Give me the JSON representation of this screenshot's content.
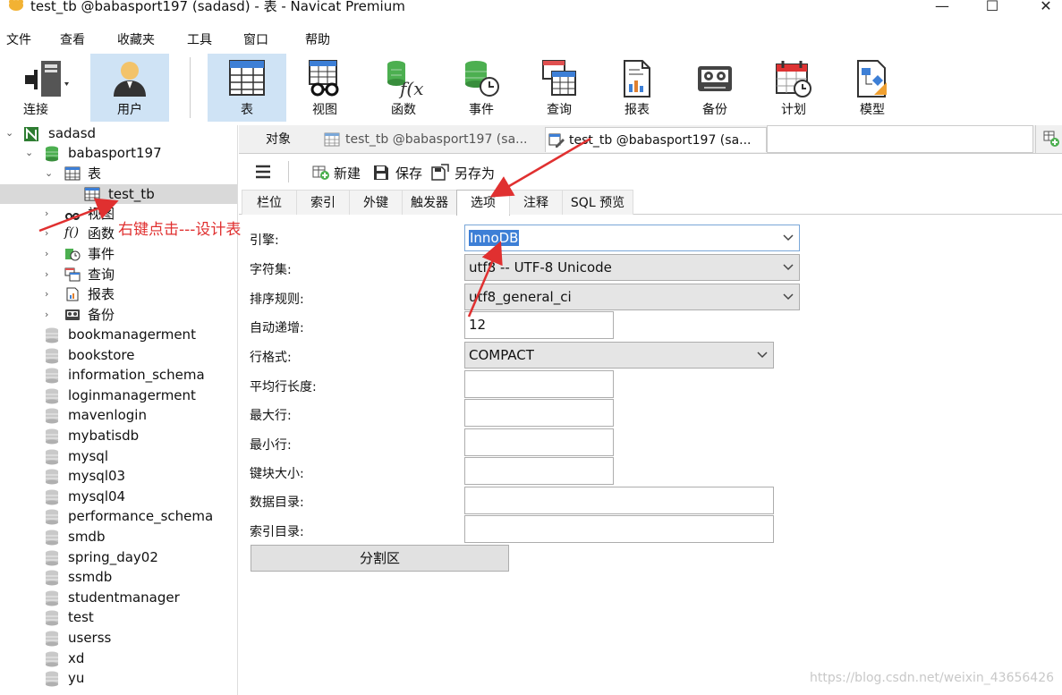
{
  "window": {
    "title": "test_tb @babasport197 (sadasd) - 表 - Navicat Premium",
    "minimize": "—",
    "maximize": "☐",
    "close": "✕"
  },
  "menu": [
    "文件",
    "查看",
    "收藏夹",
    "工具",
    "窗口",
    "帮助"
  ],
  "toolbar": {
    "connect": "连接",
    "user": "用户",
    "table": "表",
    "view": "视图",
    "function": "函数",
    "event": "事件",
    "query": "查询",
    "report": "报表",
    "backup": "备份",
    "schedule": "计划",
    "model": "模型"
  },
  "tree": {
    "connection": "sadasd",
    "database": "babasport197",
    "tables_node": "表",
    "table_item": "test_tb",
    "views": "视图",
    "functions": "函数",
    "events": "事件",
    "queries": "查询",
    "reports": "报表",
    "backups": "备份",
    "other_databases": [
      "bookmanagerment",
      "bookstore",
      "information_schema",
      "loginmanagerment",
      "mavenlogin",
      "mybatisdb",
      "mysql",
      "mysql03",
      "mysql04",
      "performance_schema",
      "smdb",
      "spring_day02",
      "ssmdb",
      "studentmanager",
      "test",
      "userss",
      "xd",
      "yu"
    ]
  },
  "tabs": {
    "objects": "对象",
    "tab1": "test_tb @babasport197 (sa...",
    "tab2": "test_tb @babasport197 (sa..."
  },
  "actions": {
    "new": "新建",
    "save": "保存",
    "save_as": "另存为"
  },
  "subtabs": [
    "栏位",
    "索引",
    "外键",
    "触发器",
    "选项",
    "注释",
    "SQL 预览"
  ],
  "form": {
    "engine_label": "引擎:",
    "engine_value": "InnoDB",
    "charset_label": "字符集:",
    "charset_value": "utf8 -- UTF-8 Unicode",
    "collation_label": "排序规则:",
    "collation_value": "utf8_general_ci",
    "auto_increment_label": "自动递增:",
    "auto_increment_value": "12",
    "row_format_label": "行格式:",
    "row_format_value": "COMPACT",
    "avg_row_length_label": "平均行长度:",
    "max_rows_label": "最大行:",
    "min_rows_label": "最小行:",
    "key_block_size_label": "键块大小:",
    "data_directory_label": "数据目录:",
    "index_directory_label": "索引目录:",
    "partition_button": "分割区"
  },
  "annotation": "右键点击---设计表",
  "watermark": "https://blog.csdn.net/weixin_43656426",
  "colors": {
    "accent_active": "#cfe3f5",
    "selection": "#3d7fd6",
    "annotation": "#e03030"
  }
}
